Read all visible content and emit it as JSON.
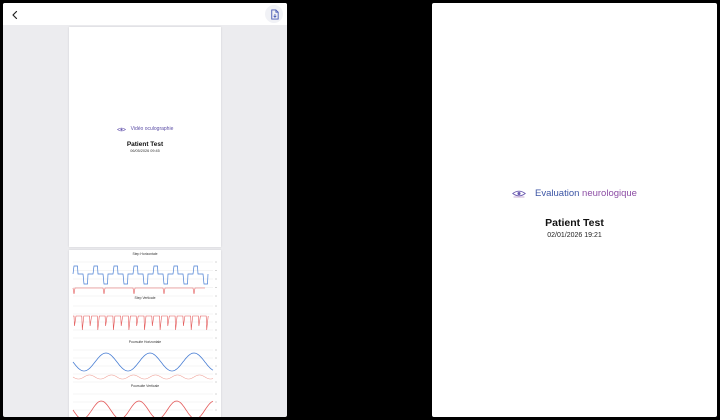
{
  "left": {
    "preview": {
      "page1": {
        "title": "Vidéo oculographie",
        "patient_name": "Patient Test",
        "date": "06/05/2026 09:45"
      },
      "charts": [
        {
          "label": "Step Horizontale",
          "color": "#4a7fd4",
          "secondary": "#e45b5b"
        },
        {
          "label": "Step Verticale",
          "color": "#e45b5b"
        },
        {
          "label": "Poursuite Horizontale",
          "color": "#4a7fd4",
          "secondary": "#f0a39a"
        },
        {
          "label": "Poursuite Verticale",
          "color": "#e45b5b"
        }
      ]
    }
  },
  "right": {
    "title_part1": "Evaluation ",
    "title_part2": "neurologique",
    "patient_name": "Patient Test",
    "date": "02/01/2026 19:21"
  },
  "colors": {
    "brand_blue": "#3c55a5",
    "brand_purple": "#8d4ea5",
    "export_icon": "#4a5bb5"
  }
}
